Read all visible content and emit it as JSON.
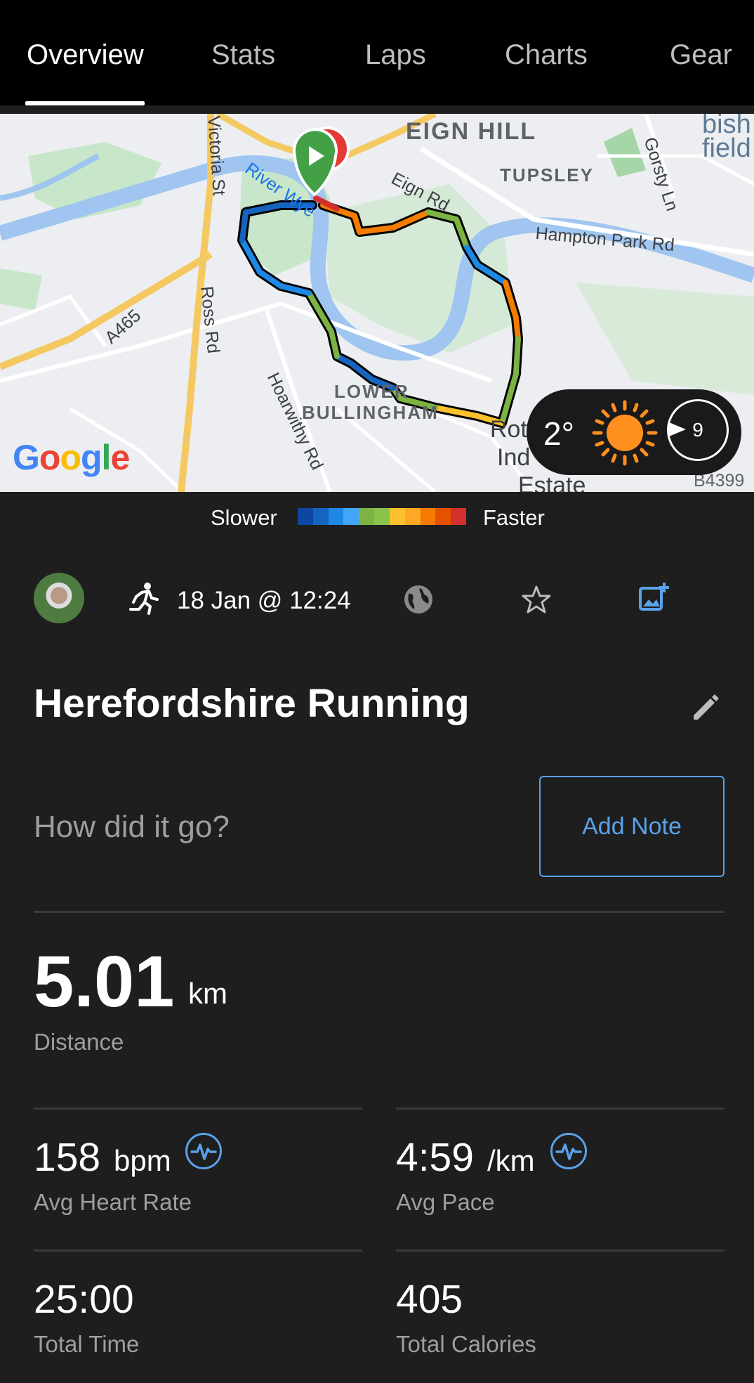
{
  "tabs": [
    "Overview",
    "Stats",
    "Laps",
    "Charts",
    "Gear"
  ],
  "map": {
    "places": {
      "eign_hill": "EIGN HILL",
      "tupsley": "TUPSLEY",
      "lower": "LOWER",
      "bullingham": "BULLINGHAM",
      "bishop_a": "bish",
      "bishop_b": "field",
      "rot": "Rot",
      "ind": "Ind",
      "estate": "Estate"
    },
    "roads": {
      "victoria_st": "Victoria St",
      "river_wye": "River Wye",
      "eign_rd": "Eign Rd",
      "gorsty_ln": "Gorsty Ln",
      "hampton_park_rd": "Hampton Park Rd",
      "a465": "A465",
      "ross_rd": "Ross Rd",
      "hoarwithy_rd": "Hoarwithy Rd",
      "b4399": "B4399"
    },
    "attribution": "Google"
  },
  "weather": {
    "temperature": "2°",
    "wind": "9",
    "icon": "sun-icon"
  },
  "pace_legend": {
    "slower": "Slower",
    "faster": "Faster",
    "colors": [
      "#0d47a1",
      "#1565c0",
      "#1e88e5",
      "#42a5f5",
      "#7cb342",
      "#8bc34a",
      "#fbc02d",
      "#ffa726",
      "#f57c00",
      "#e65100",
      "#d32f2f"
    ]
  },
  "activity": {
    "date": "18 Jan @ 12:24",
    "type_icon": "running-icon",
    "title": "Herefordshire Running",
    "note_prompt": "How did it go?",
    "add_note_label": "Add Note"
  },
  "stats": {
    "distance": {
      "value": "5.01",
      "unit": "km",
      "label": "Distance"
    },
    "avg_heart_rate": {
      "value": "158",
      "unit": "bpm",
      "label": "Avg Heart Rate"
    },
    "avg_pace": {
      "value": "4:59",
      "unit": "/km",
      "label": "Avg Pace"
    },
    "total_time": {
      "value": "25:00",
      "label": "Total Time"
    },
    "total_calories": {
      "value": "405",
      "label": "Total Calories"
    }
  },
  "colors": {
    "accent": "#5aa2e8",
    "background": "#1e1e1e",
    "header": "#000000"
  }
}
